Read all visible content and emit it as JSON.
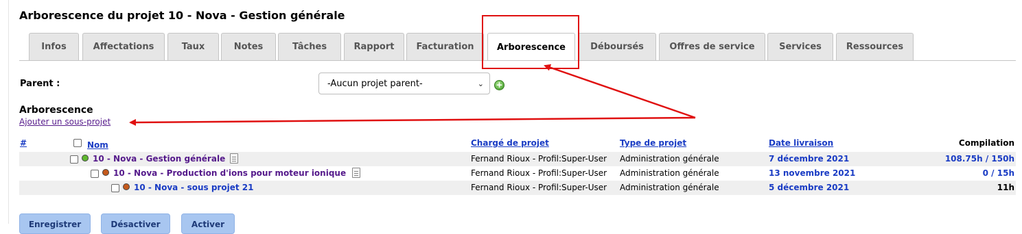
{
  "page": {
    "title": "Arborescence du projet 10 - Nova - Gestion générale"
  },
  "tabs": [
    {
      "label": "Infos"
    },
    {
      "label": "Affectations"
    },
    {
      "label": "Taux"
    },
    {
      "label": "Notes"
    },
    {
      "label": "Tâches"
    },
    {
      "label": "Rapport"
    },
    {
      "label": "Facturation"
    },
    {
      "label": "Arborescence",
      "active": true
    },
    {
      "label": "Déboursés"
    },
    {
      "label": "Offres de service"
    },
    {
      "label": "Services"
    },
    {
      "label": "Ressources"
    }
  ],
  "parent": {
    "label": "Parent :",
    "selected": "-Aucun projet parent-"
  },
  "tree": {
    "title": "Arborescence",
    "add_link": "Ajouter un sous-projet",
    "headers": {
      "num": "#",
      "name": "Nom",
      "manager": "Chargé de projet",
      "type": "Type de projet",
      "delivery": "Date livraison",
      "compilation": "Compilation"
    },
    "rows": [
      {
        "name": "10 - Nova - Gestion générale",
        "manager": "Fernand Rioux - Profil:Super-User",
        "type": "Administration générale",
        "delivery": "7 décembre 2021",
        "compilation": "108.75h / 150h",
        "status": "green"
      },
      {
        "name": "10 - Nova - Production d'ions pour moteur ionique",
        "manager": "Fernand Rioux - Profil:Super-User",
        "type": "Administration générale",
        "delivery": "13 novembre 2021",
        "compilation": "0 / 15h",
        "status": "orange"
      },
      {
        "name": "10 - Nova - sous projet 21",
        "manager": "Fernand Rioux - Profil:Super-User",
        "type": "Administration générale",
        "delivery": "5 décembre 2021",
        "compilation": "11h",
        "status": "orange"
      }
    ]
  },
  "buttons": {
    "save": "Enregistrer",
    "deactivate": "Désactiver",
    "activate": "Activer"
  },
  "colors": {
    "status_green": "#5fb82f",
    "status_orange": "#c55a1c",
    "link_blue": "#1a3cc4",
    "link_purple": "#551a8b",
    "annotation_red": "#e01010"
  }
}
